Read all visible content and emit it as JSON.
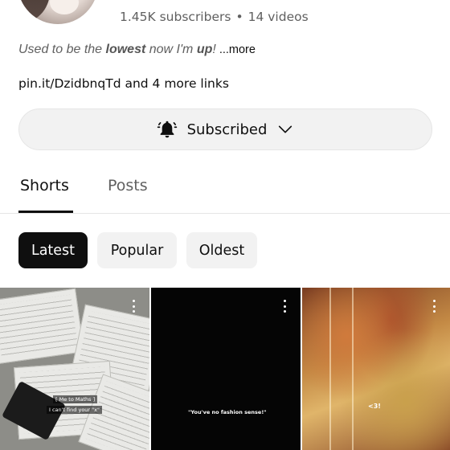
{
  "channel": {
    "subscribers": "1.45K subscribers",
    "separator": "•",
    "videos": "14 videos",
    "bio": {
      "part1": "Used to be the ",
      "bold1": "lowest",
      "part2": " now I'm ",
      "bold2": "up",
      "part3": "!",
      "more": "...more"
    },
    "links": "pin.it/DzidbnqTd and 4 more links"
  },
  "subscribe_button": {
    "label": "Subscribed",
    "icon": "bell-icon",
    "chevron": "chevron-down-icon"
  },
  "tabs": [
    {
      "label": "Shorts",
      "selected": true
    },
    {
      "label": "Posts",
      "selected": false
    }
  ],
  "chips": [
    {
      "label": "Latest",
      "selected": true
    },
    {
      "label": "Popular",
      "selected": false
    },
    {
      "label": "Oldest",
      "selected": false
    }
  ],
  "shorts": [
    {
      "captions": [
        "[ Me to Maths ]",
        "I can't find your \"x\""
      ]
    },
    {
      "captions": [
        "\"You've no fashion sense!\""
      ]
    },
    {
      "captions": [
        "<3!"
      ]
    }
  ],
  "colors": {
    "text_primary": "#0f0f0f",
    "text_secondary": "#606060",
    "chip_selected": "#0f0f0f",
    "chip_default": "#f2f2f2"
  }
}
